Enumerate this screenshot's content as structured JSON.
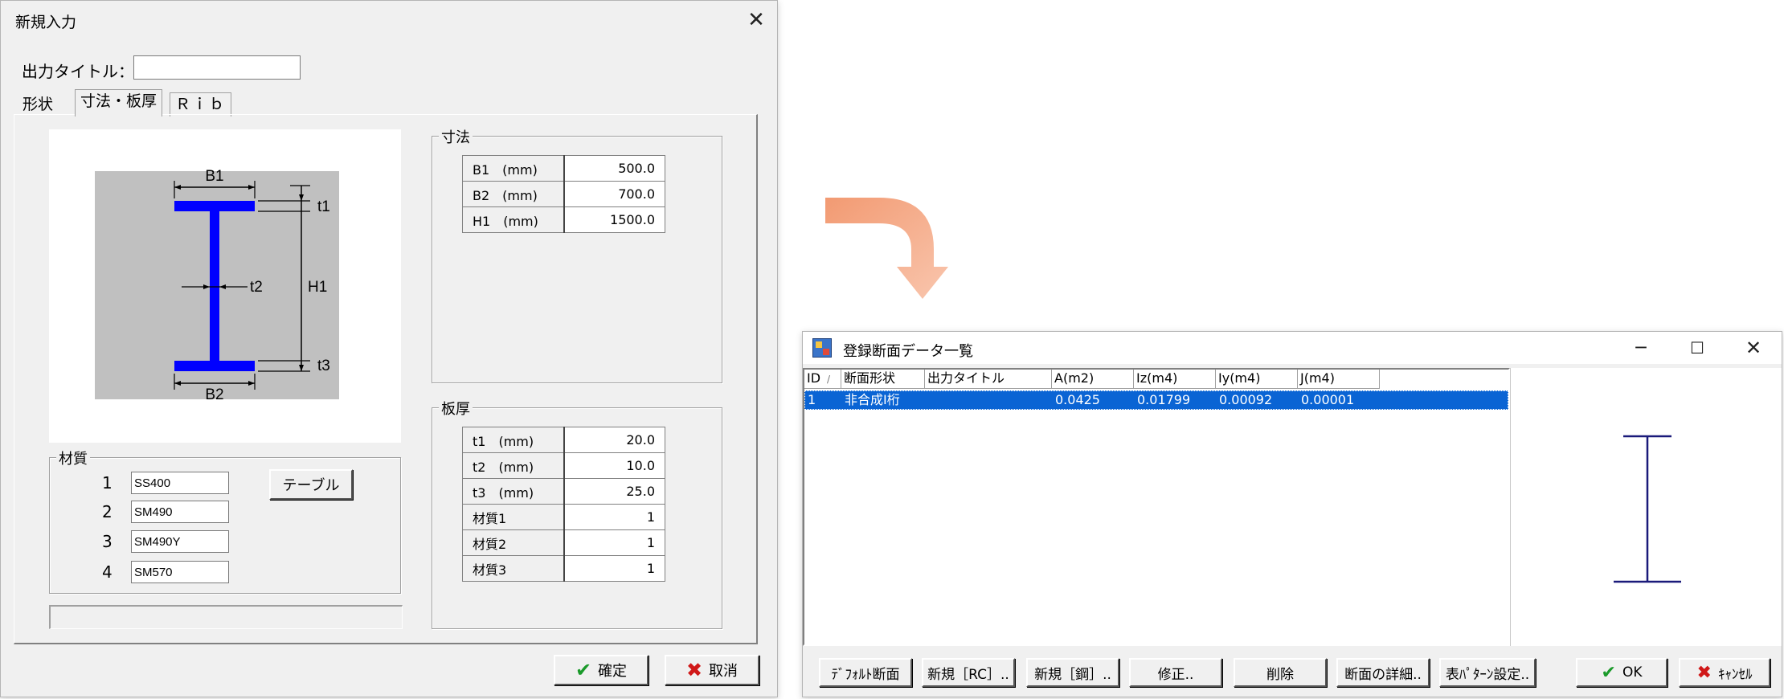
{
  "dialog": {
    "title": "新規入力",
    "output_title_label": "出力タイトル：",
    "output_title_value": "",
    "tabs": [
      {
        "label": "形状"
      },
      {
        "label": "寸法・板厚"
      },
      {
        "label": "Ｒｉｂ"
      }
    ],
    "diagram": {
      "labels": {
        "b1": "B1",
        "b2": "B2",
        "t1": "t1",
        "t2": "t2",
        "t3": "t3",
        "h1": "H1"
      },
      "beam_color": "#0000ff",
      "background_color": "#c0c0c0"
    },
    "material": {
      "legend": "材質",
      "rows": [
        {
          "index": "1",
          "value": "SS400"
        },
        {
          "index": "2",
          "value": "SM490"
        },
        {
          "index": "3",
          "value": "SM490Y"
        },
        {
          "index": "4",
          "value": "SM570"
        }
      ],
      "table_button": "テーブル"
    },
    "dimensions": {
      "legend": "寸法",
      "rows": [
        {
          "name": "B1　(mm)",
          "value": "500.0"
        },
        {
          "name": "B2　(mm)",
          "value": "700.0"
        },
        {
          "name": "H1　(mm)",
          "value": "1500.0"
        }
      ]
    },
    "thickness": {
      "legend": "板厚",
      "rows": [
        {
          "name": "t1　(mm)",
          "value": "20.0"
        },
        {
          "name": "t2　(mm)",
          "value": "10.0"
        },
        {
          "name": "t3　(mm)",
          "value": "25.0"
        },
        {
          "name": "材質1",
          "value": "1"
        },
        {
          "name": "材質2",
          "value": "1"
        },
        {
          "name": "材質3",
          "value": "1"
        }
      ]
    },
    "ok_label": "確定",
    "cancel_label": "取消"
  },
  "arrow": {
    "color": "#f4a884"
  },
  "list_window": {
    "title": "登録断面データ一覧",
    "columns": [
      "ID",
      "断面形状",
      "出力タイトル",
      "A(m2)",
      "Iz(m4)",
      "Iy(m4)",
      "J(m4)"
    ],
    "rows": [
      {
        "id": "1",
        "shape": "非合成I桁",
        "title": "",
        "a": "0.0425",
        "iz": "0.01799",
        "iy": "0.00092",
        "j": "0.00001"
      }
    ],
    "selection_color": "#0a64d4",
    "preview_color": "#1a1a7a",
    "buttons": {
      "default": "ﾃﾞﾌｫﾙﾄ断面",
      "new_rc": "新規［RC］..",
      "new_steel": "新規［鋼］..",
      "edit": "修正..",
      "delete": "削除",
      "detail": "断面の詳細..",
      "pattern": "表ﾊﾟﾀｰﾝ設定..",
      "ok": "OK",
      "cancel": "ｷｬﾝｾﾙ"
    }
  }
}
